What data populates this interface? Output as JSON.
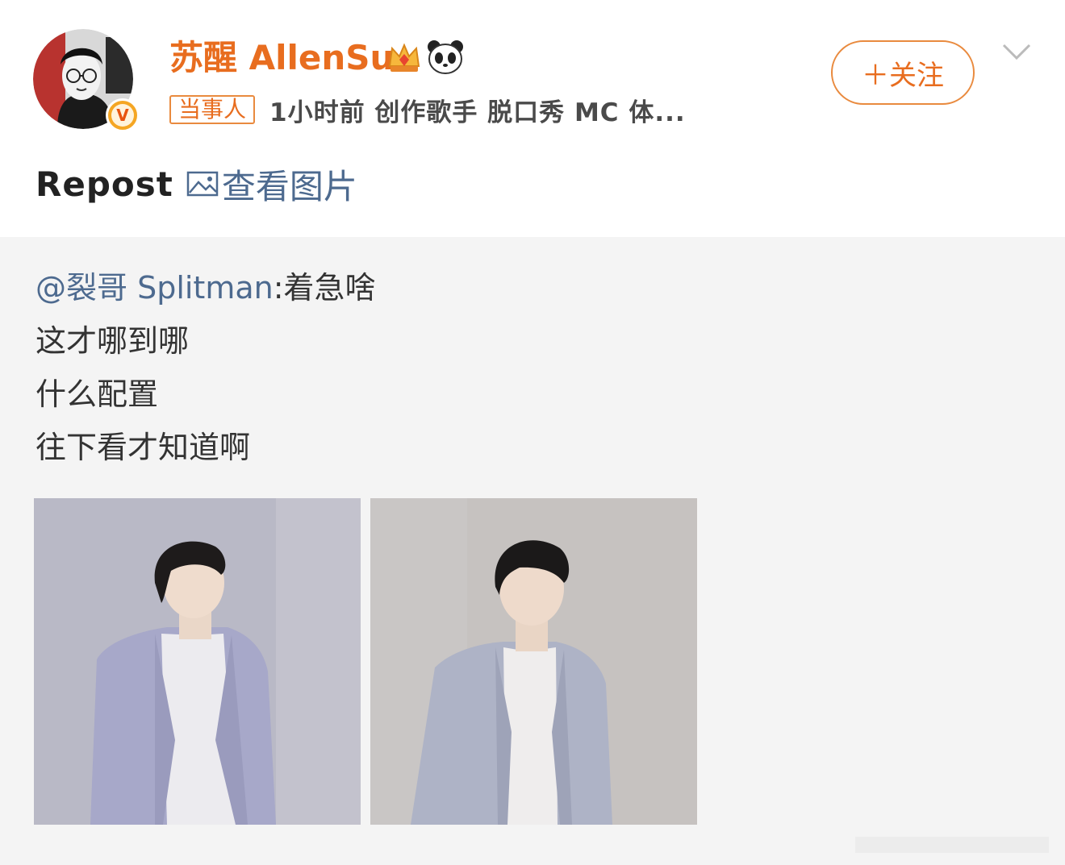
{
  "post": {
    "author": {
      "name": "苏醒 AllenSu",
      "badges": [
        "crown-icon",
        "panda-icon"
      ],
      "verified": true
    },
    "tag": "当事人",
    "meta": "1小时前  创作歌手 脱口秀 MC 体...",
    "follow_label": "＋关注",
    "text": "Repost",
    "image_link_label": "查看图片"
  },
  "repost": {
    "mention": "@裂哥 Splitman",
    "first_line_text": ":着急啥",
    "lines": [
      "这才哪到哪",
      "什么配置",
      "往下看才知道啊"
    ]
  },
  "colors": {
    "accent": "#e86d1f",
    "link": "#4d6a8f",
    "repost_bg": "#f4f4f4",
    "text": "#333333"
  }
}
